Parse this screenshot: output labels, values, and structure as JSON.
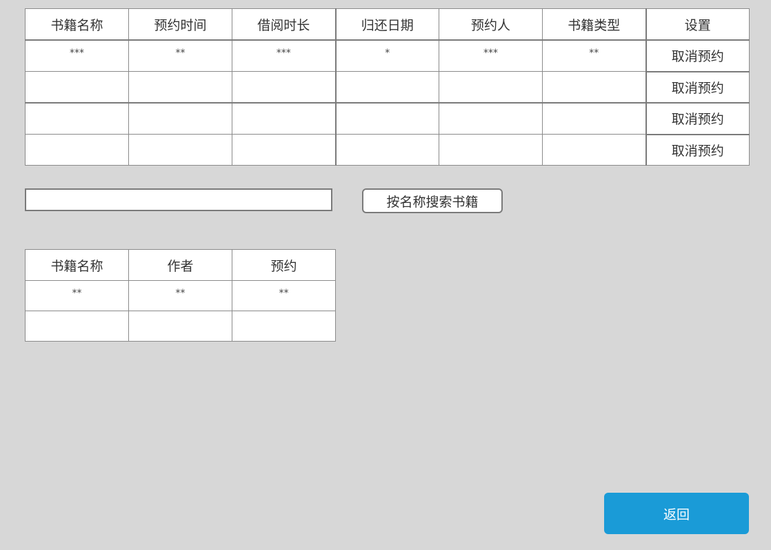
{
  "reservations": {
    "headers": [
      "书籍名称",
      "预约时间",
      "借阅时长",
      "归还日期",
      "预约人",
      "书籍类型",
      "设置"
    ],
    "rows": [
      [
        "***",
        "**",
        "***",
        "*",
        "***",
        "**",
        "取消预约"
      ],
      [
        "",
        "",
        "",
        "",
        "",
        "",
        "取消预约"
      ],
      [
        "",
        "",
        "",
        "",
        "",
        "",
        "取消预约"
      ],
      [
        "",
        "",
        "",
        "",
        "",
        "",
        "取消预约"
      ]
    ]
  },
  "search": {
    "value": "",
    "placeholder": "",
    "button_label": "按名称搜索书籍"
  },
  "books": {
    "headers": [
      "书籍名称",
      "作者",
      "预约"
    ],
    "rows": [
      [
        "**",
        "**",
        "**"
      ],
      [
        "",
        "",
        ""
      ]
    ]
  },
  "footer": {
    "back_label": "返回"
  },
  "colors": {
    "background": "#d7d7d7",
    "accent": "#1a9bd7"
  }
}
